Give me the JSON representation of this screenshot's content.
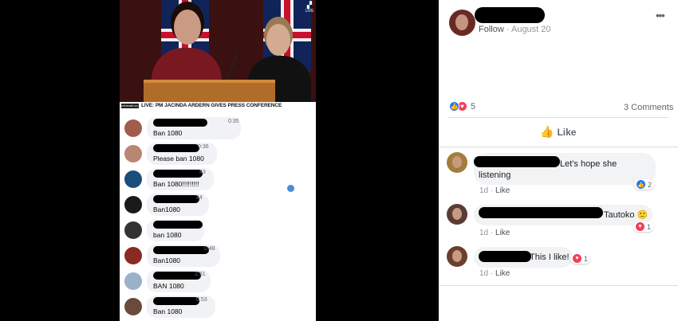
{
  "video": {
    "banner_logo": "nzherald.co.nz",
    "banner_text": "LIVE: PM JACINDA ARDERN GIVES PRESS CONFERENCE",
    "live_label": "LIVE"
  },
  "stream_comments": [
    {
      "time": "0:35",
      "text": "Ban 1080"
    },
    {
      "time": "0:36",
      "text": "Please ban 1080"
    },
    {
      "time": "43",
      "text": "Ban 1080!!!!!!!!!"
    },
    {
      "time": "44",
      "text": "Ban1080"
    },
    {
      "time": "",
      "text": "ban 1080"
    },
    {
      "time": "0:48",
      "text": "Ban1080"
    },
    {
      "time": "2:51",
      "text": "BAN 1080"
    },
    {
      "time": "0:53",
      "text": "Ban 1080"
    }
  ],
  "post": {
    "follow_label": "Follow",
    "separator": "·",
    "date": "August 20",
    "more_icon": "more-horizontal-icon",
    "reaction_count": "5",
    "comment_count": "3 Comments",
    "like_label": "Like"
  },
  "post_comments": [
    {
      "text": "Let's hope she listening",
      "age": "1d",
      "like": "Like",
      "reaction_count": "2",
      "reaction": "like"
    },
    {
      "text": "Tautoko 🙂",
      "age": "1d",
      "like": "Like",
      "reaction_count": "1",
      "reaction": "love"
    },
    {
      "text": "This I like!",
      "age": "1d",
      "like": "Like",
      "reaction_count": "1",
      "reaction": "love"
    }
  ],
  "colors": {
    "like_blue": "#2078f4",
    "love_red": "#f33e58",
    "meta_gray": "#90949c"
  }
}
